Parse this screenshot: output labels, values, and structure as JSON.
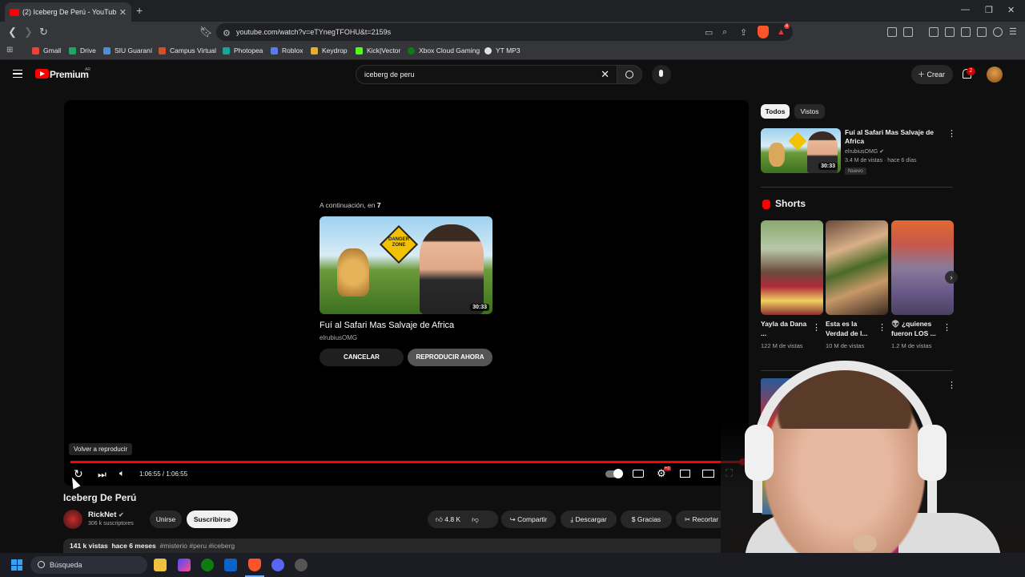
{
  "browser": {
    "tab_title": "(2) Iceberg De Perú - YouTube",
    "url": "youtube.com/watch?v=eTYnegTFOHU&t=2159s",
    "bookmarks": [
      "Gmail",
      "Drive",
      "SIU Guaraní",
      "Campus Virtual",
      "Photopea",
      "Roblox",
      "Keydrop",
      "Kick|Vector",
      "Xbox Cloud Gaming",
      "YT MP3"
    ],
    "extension_badge": "6"
  },
  "header": {
    "logo_text": "Premium",
    "region": "AR",
    "search_value": "iceberg de peru",
    "create_label": "Crear",
    "notifications_count": "2"
  },
  "player": {
    "upnext_label": "A continuación, en",
    "upnext_seconds": "7",
    "upnext_title": "Fuí al Safari Mas Salvaje de Africa",
    "upnext_channel": "elrubiusOMG",
    "upnext_duration": "30:33",
    "danger_sign": "DANGER ZONE",
    "cancel_label": "CANCELAR",
    "play_now_label": "REPRODUCIR AHORA",
    "tooltip": "Volver a reproducir",
    "time": "1:06:55 / 1:06:55",
    "progress_fraction": 1.0,
    "hd_badge": "HD"
  },
  "video": {
    "title": "Iceberg De Perú",
    "channel": "RickNet",
    "subscribers": "306 k suscriptores",
    "join_label": "Unirse",
    "subscribe_label": "Suscribirse",
    "likes": "4.8 K",
    "share_label": "Compartir",
    "download_label": "Descargar",
    "thanks_label": "Gracias",
    "clip_label": "Recortar",
    "views": "141 k vistas",
    "ago": "hace 6 meses",
    "tags": "#misterio #peru #iceberg"
  },
  "sidebar": {
    "chips": [
      "Todos",
      "Vistos"
    ],
    "rec": {
      "title": "Fuí al Safari Mas Salvaje de Africa",
      "channel": "elrubiusOMG",
      "meta": "3.4 M de vistas · hace 6 días",
      "badge": "Nuevo",
      "duration": "30:33"
    },
    "shorts_heading": "Shorts",
    "shorts": [
      {
        "title": "Yayla da Dana ...",
        "views": "122 M de vistas"
      },
      {
        "title": "Esta es la Verdad de l...",
        "views": "10 M de vistas"
      },
      {
        "title": "👽 ¿quienes fueron LOS ...",
        "views": "1.2 M de vistas"
      }
    ]
  },
  "taskbar": {
    "search_placeholder": "Búsqueda"
  },
  "icons": [
    "menu-icon",
    "search-icon",
    "mic-icon",
    "bell-icon",
    "replay-icon",
    "next-icon",
    "volume-icon",
    "settings-icon",
    "fullscreen-icon"
  ]
}
